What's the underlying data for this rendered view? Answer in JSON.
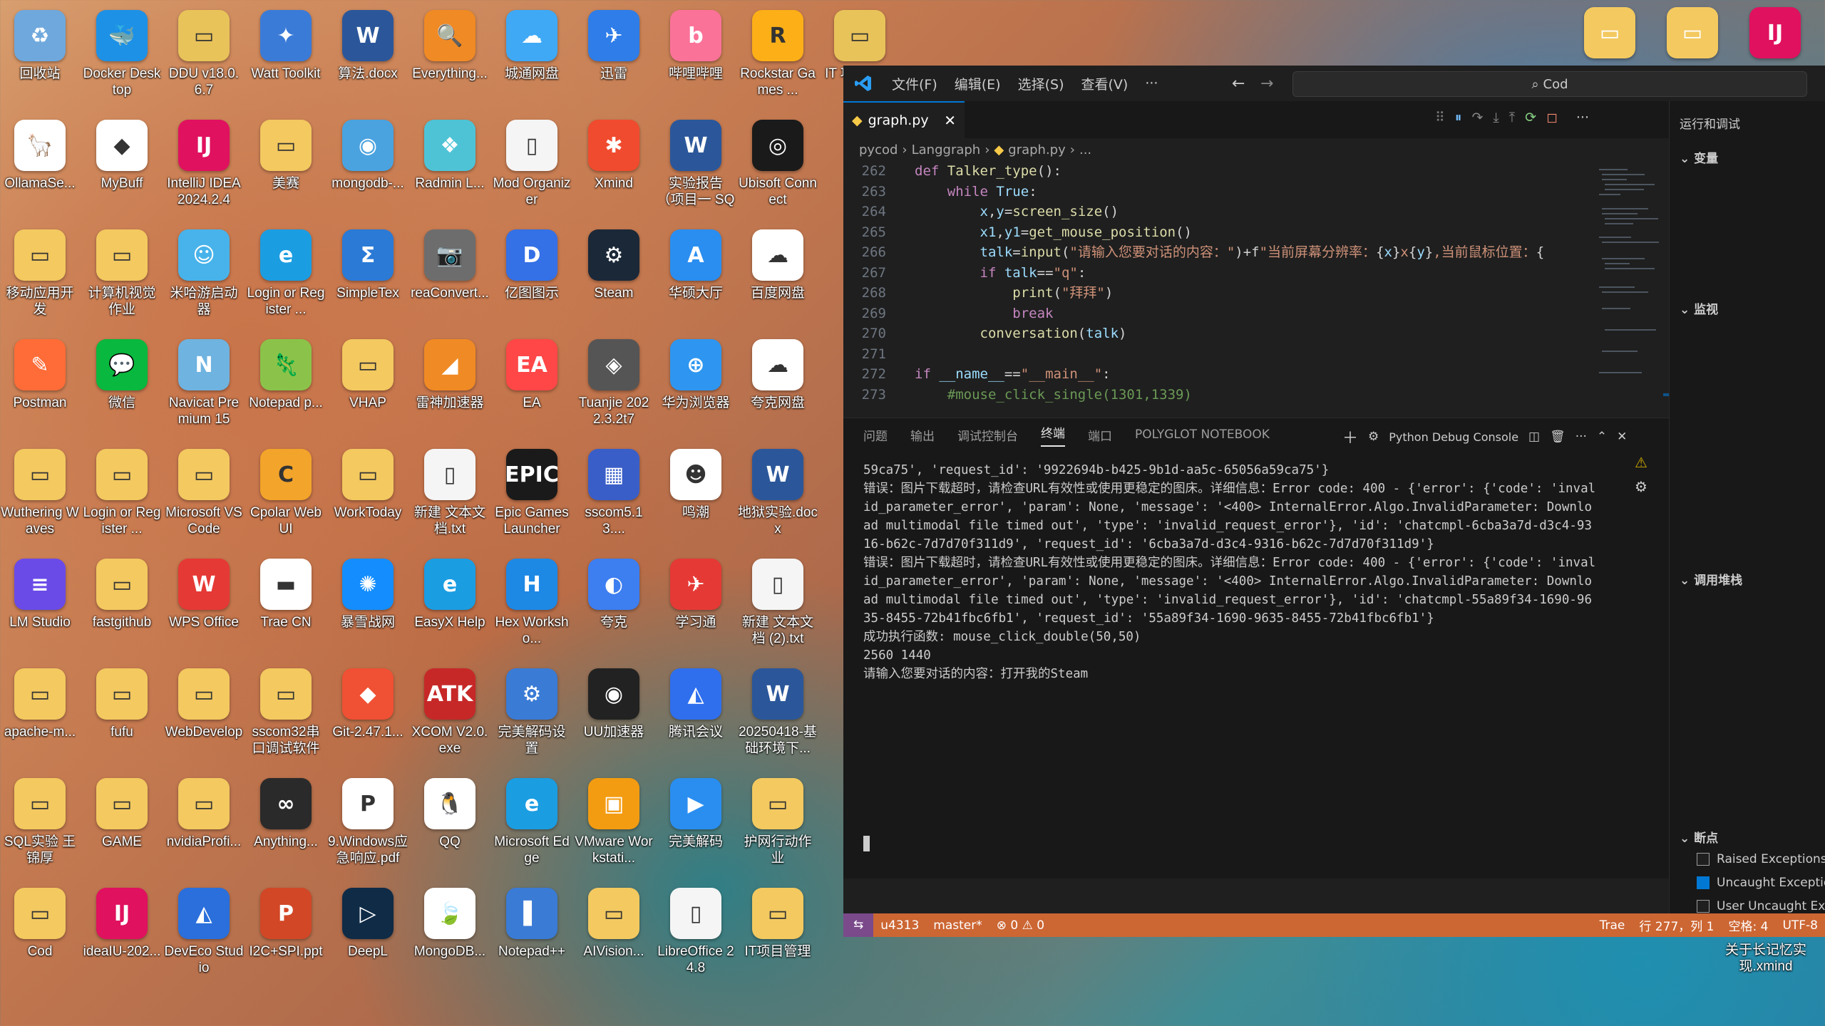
{
  "desktop_icons": [
    {
      "label": "回收站",
      "col": 0,
      "row": 0,
      "color": "#6fa8dc",
      "glyph": "♻"
    },
    {
      "label": "Docker Desktop",
      "col": 1,
      "row": 0,
      "color": "#1d91e6",
      "glyph": "🐳"
    },
    {
      "label": "DDU v18.0.6.7",
      "col": 2,
      "row": 0,
      "color": "#e8c35a",
      "glyph": "▭"
    },
    {
      "label": "Watt Toolkit",
      "col": 3,
      "row": 0,
      "color": "#3b7bd8",
      "glyph": "✦"
    },
    {
      "label": "算法.docx",
      "col": 4,
      "row": 0,
      "color": "#2b579a",
      "glyph": "W"
    },
    {
      "label": "Everything...",
      "col": 5,
      "row": 0,
      "color": "#f08a24",
      "glyph": "🔍"
    },
    {
      "label": "城通网盘",
      "col": 6,
      "row": 0,
      "color": "#3fa9f5",
      "glyph": "☁"
    },
    {
      "label": "迅雷",
      "col": 7,
      "row": 0,
      "color": "#2e7de9",
      "glyph": "✈"
    },
    {
      "label": "哔哩哔哩",
      "col": 8,
      "row": 0,
      "color": "#fb7299",
      "glyph": "b"
    },
    {
      "label": "Rockstar Games ...",
      "col": 9,
      "row": 0,
      "color": "#fcaf17",
      "glyph": "R"
    },
    {
      "label": "IT 项目管理",
      "col": 10,
      "row": 0,
      "color": "#e8c35a",
      "glyph": "▭"
    },
    {
      "label": "OllamaSe...",
      "col": 0,
      "row": 1,
      "color": "#ffffff",
      "glyph": "🦙"
    },
    {
      "label": "MyBuff",
      "col": 1,
      "row": 1,
      "color": "#ffffff",
      "glyph": "◆"
    },
    {
      "label": "IntelliJ IDEA 2024.2.4",
      "col": 2,
      "row": 1,
      "color": "#e0115f",
      "glyph": "IJ"
    },
    {
      "label": "美赛",
      "col": 3,
      "row": 1,
      "color": "#f3c960",
      "glyph": "▭"
    },
    {
      "label": "mongodb-...",
      "col": 4,
      "row": 1,
      "color": "#4aa3df",
      "glyph": "◉"
    },
    {
      "label": "Radmin L...",
      "col": 5,
      "row": 1,
      "color": "#4fc3d6",
      "glyph": "❖"
    },
    {
      "label": "Mod Organizer",
      "col": 6,
      "row": 1,
      "color": "#f5f5f5",
      "glyph": "▯"
    },
    {
      "label": "Xmind",
      "col": 7,
      "row": 1,
      "color": "#f04b2e",
      "glyph": "✱"
    },
    {
      "label": "实验报告（项目一 SQL语...",
      "col": 8,
      "row": 1,
      "color": "#2b579a",
      "glyph": "W"
    },
    {
      "label": "Ubisoft Connect",
      "col": 9,
      "row": 1,
      "color": "#1a1a1a",
      "glyph": "◎"
    },
    {
      "label": "移动应用开发",
      "col": 0,
      "row": 2,
      "color": "#f3c960",
      "glyph": "▭"
    },
    {
      "label": "计算机视觉作业",
      "col": 1,
      "row": 2,
      "color": "#f3c960",
      "glyph": "▭"
    },
    {
      "label": "米哈游启动器",
      "col": 2,
      "row": 2,
      "color": "#48b3ea",
      "glyph": "☺"
    },
    {
      "label": "Login or Register ...",
      "col": 3,
      "row": 2,
      "color": "#1b9de2",
      "glyph": "e"
    },
    {
      "label": "SimpleTex",
      "col": 4,
      "row": 2,
      "color": "#2a7ad6",
      "glyph": "Σ"
    },
    {
      "label": "reaConvert...",
      "col": 5,
      "row": 2,
      "color": "#6d6d6d",
      "glyph": "📷"
    },
    {
      "label": "亿图图示",
      "col": 6,
      "row": 2,
      "color": "#3470e6",
      "glyph": "D"
    },
    {
      "label": "Steam",
      "col": 7,
      "row": 2,
      "color": "#1b2838",
      "glyph": "⚙"
    },
    {
      "label": "华硕大厅",
      "col": 8,
      "row": 2,
      "color": "#2a8ef0",
      "glyph": "A"
    },
    {
      "label": "百度网盘",
      "col": 9,
      "row": 2,
      "color": "#ffffff",
      "glyph": "☁"
    },
    {
      "label": "Postman",
      "col": 0,
      "row": 3,
      "color": "#ff6c37",
      "glyph": "✎"
    },
    {
      "label": "微信",
      "col": 1,
      "row": 3,
      "color": "#09b83e",
      "glyph": "💬"
    },
    {
      "label": "Navicat Premium 15",
      "col": 2,
      "row": 3,
      "color": "#6fb3e0",
      "glyph": "N"
    },
    {
      "label": "Notepad p...",
      "col": 3,
      "row": 3,
      "color": "#8bc34a",
      "glyph": "🦎"
    },
    {
      "label": "VHAP",
      "col": 4,
      "row": 3,
      "color": "#f3c960",
      "glyph": "▭"
    },
    {
      "label": "雷神加速器",
      "col": 5,
      "row": 3,
      "color": "#f08a24",
      "glyph": "◢"
    },
    {
      "label": "EA",
      "col": 6,
      "row": 3,
      "color": "#ff4747",
      "glyph": "EA"
    },
    {
      "label": "Tuanjie 2022.3.2t7",
      "col": 7,
      "row": 3,
      "color": "#555555",
      "glyph": "◈"
    },
    {
      "label": "华为浏览器",
      "col": 8,
      "row": 3,
      "color": "#2e96f0",
      "glyph": "⊕"
    },
    {
      "label": "夸克网盘",
      "col": 9,
      "row": 3,
      "color": "#ffffff",
      "glyph": "☁"
    },
    {
      "label": "Wuthering Waves",
      "col": 0,
      "row": 4,
      "color": "#f3c960",
      "glyph": "▭"
    },
    {
      "label": "Login or Register ...",
      "col": 1,
      "row": 4,
      "color": "#f3c960",
      "glyph": "▭"
    },
    {
      "label": "Microsoft VS Code",
      "col": 2,
      "row": 4,
      "color": "#f3c960",
      "glyph": "▭"
    },
    {
      "label": "Cpolar Web UI",
      "col": 3,
      "row": 4,
      "color": "#f3a42a",
      "glyph": "C"
    },
    {
      "label": "WorkToday",
      "col": 4,
      "row": 4,
      "color": "#f3c960",
      "glyph": "▭"
    },
    {
      "label": "新建 文本文档.txt",
      "col": 5,
      "row": 4,
      "color": "#f5f5f5",
      "glyph": "▯"
    },
    {
      "label": "Epic Games Launcher",
      "col": 6,
      "row": 4,
      "color": "#1a1a1a",
      "glyph": "EPIC"
    },
    {
      "label": "sscom5.13....",
      "col": 7,
      "row": 4,
      "color": "#3a5ec8",
      "glyph": "▦"
    },
    {
      "label": "鸣潮",
      "col": 8,
      "row": 4,
      "color": "#ffffff",
      "glyph": "☻"
    },
    {
      "label": "地狱实验.docx",
      "col": 9,
      "row": 4,
      "color": "#2b579a",
      "glyph": "W"
    },
    {
      "label": "LM Studio",
      "col": 0,
      "row": 5,
      "color": "#6a4be8",
      "glyph": "≡"
    },
    {
      "label": "fastgithub",
      "col": 1,
      "row": 5,
      "color": "#f3c960",
      "glyph": "▭"
    },
    {
      "label": "WPS Office",
      "col": 2,
      "row": 5,
      "color": "#e53935",
      "glyph": "W"
    },
    {
      "label": "Trae CN",
      "col": 3,
      "row": 5,
      "color": "#ffffff",
      "glyph": "▬"
    },
    {
      "label": "暴雪战网",
      "col": 4,
      "row": 5,
      "color": "#148eff",
      "glyph": "✺"
    },
    {
      "label": "EasyX Help",
      "col": 5,
      "row": 5,
      "color": "#1b9de2",
      "glyph": "e"
    },
    {
      "label": "Hex Worksho...",
      "col": 6,
      "row": 5,
      "color": "#1e88e5",
      "glyph": "H"
    },
    {
      "label": "夸克",
      "col": 7,
      "row": 5,
      "color": "#3d7ef0",
      "glyph": "◐"
    },
    {
      "label": "学习通",
      "col": 8,
      "row": 5,
      "color": "#e53935",
      "glyph": "✈"
    },
    {
      "label": "新建 文本文档 (2).txt",
      "col": 9,
      "row": 5,
      "color": "#f5f5f5",
      "glyph": "▯"
    },
    {
      "label": "apache-m...",
      "col": 0,
      "row": 6,
      "color": "#f3c960",
      "glyph": "▭"
    },
    {
      "label": "fufu",
      "col": 1,
      "row": 6,
      "color": "#f3c960",
      "glyph": "▭"
    },
    {
      "label": "WebDevelop",
      "col": 2,
      "row": 6,
      "color": "#f3c960",
      "glyph": "▭"
    },
    {
      "label": "sscom32串口调试软件",
      "col": 3,
      "row": 6,
      "color": "#f3c960",
      "glyph": "▭"
    },
    {
      "label": "Git-2.47.1...",
      "col": 4,
      "row": 6,
      "color": "#f05033",
      "glyph": "◆"
    },
    {
      "label": "XCOM V2.0.exe",
      "col": 5,
      "row": 6,
      "color": "#c62828",
      "glyph": "ATK"
    },
    {
      "label": "完美解码设置",
      "col": 6,
      "row": 6,
      "color": "#3a7bd5",
      "glyph": "⚙"
    },
    {
      "label": "UU加速器",
      "col": 7,
      "row": 6,
      "color": "#222222",
      "glyph": "◉"
    },
    {
      "label": "腾讯会议",
      "col": 8,
      "row": 6,
      "color": "#2f6fed",
      "glyph": "◭"
    },
    {
      "label": "20250418-基础环境下...",
      "col": 9,
      "row": 6,
      "color": "#2b579a",
      "glyph": "W"
    },
    {
      "label": "SQL实验 王锦厚",
      "col": 0,
      "row": 7,
      "color": "#f3c960",
      "glyph": "▭"
    },
    {
      "label": "GAME",
      "col": 1,
      "row": 7,
      "color": "#f3c960",
      "glyph": "▭"
    },
    {
      "label": "nvidiaProfi...",
      "col": 2,
      "row": 7,
      "color": "#f3c960",
      "glyph": "▭"
    },
    {
      "label": "Anything...",
      "col": 3,
      "row": 7,
      "color": "#2a2a2a",
      "glyph": "∞"
    },
    {
      "label": "9.Windows应急响应.pdf",
      "col": 4,
      "row": 7,
      "color": "#ffffff",
      "glyph": "P"
    },
    {
      "label": "QQ",
      "col": 5,
      "row": 7,
      "color": "#ffffff",
      "glyph": "🐧"
    },
    {
      "label": "Microsoft Edge",
      "col": 6,
      "row": 7,
      "color": "#1b9de2",
      "glyph": "e"
    },
    {
      "label": "VMware Workstati...",
      "col": 7,
      "row": 7,
      "color": "#f39c12",
      "glyph": "▣"
    },
    {
      "label": "完美解码",
      "col": 8,
      "row": 7,
      "color": "#2a8ef0",
      "glyph": "▶"
    },
    {
      "label": "护网行动作业",
      "col": 9,
      "row": 7,
      "color": "#f3c960",
      "glyph": "▭"
    },
    {
      "label": "Cod",
      "col": 0,
      "row": 8,
      "color": "#f3c960",
      "glyph": "▭"
    },
    {
      "label": "ideaIU-202...",
      "col": 1,
      "row": 8,
      "color": "#e0115f",
      "glyph": "IJ"
    },
    {
      "label": "DevEco Studio",
      "col": 2,
      "row": 8,
      "color": "#2a6fdb",
      "glyph": "◭"
    },
    {
      "label": "I2C+SPI.ppt",
      "col": 3,
      "row": 8,
      "color": "#d24726",
      "glyph": "P"
    },
    {
      "label": "DeepL",
      "col": 4,
      "row": 8,
      "color": "#0f2b46",
      "glyph": "▷"
    },
    {
      "label": "MongoDB...",
      "col": 5,
      "row": 8,
      "color": "#ffffff",
      "glyph": "🍃"
    },
    {
      "label": "Notepad++",
      "col": 6,
      "row": 8,
      "color": "#3a7bd5",
      "glyph": "▌"
    },
    {
      "label": "AIVision...",
      "col": 7,
      "row": 8,
      "color": "#f3c960",
      "glyph": "▭"
    },
    {
      "label": "LibreOffice 24.8",
      "col": 8,
      "row": 8,
      "color": "#f5f5f5",
      "glyph": "▯"
    },
    {
      "label": "IT项目管理",
      "col": 9,
      "row": 8,
      "color": "#f3c960",
      "glyph": "▭"
    }
  ],
  "right_desktop": {
    "xmind_label": "关于长记忆实现.xmind"
  },
  "vscode": {
    "menu": [
      "文件(F)",
      "编辑(E)",
      "选择(S)",
      "查看(V)",
      "···"
    ],
    "search": "Cod",
    "tab": "graph.py",
    "breadcrumb": [
      "pycod",
      "Langgraph",
      "graph.py",
      "..."
    ],
    "code_lines": [
      {
        "n": "262",
        "html": "<span class='kw'>def</span> <span class='fn'>Talker_type</span>():"
      },
      {
        "n": "263",
        "html": "    <span class='kw'>while</span> <span class='vr'>True</span>:"
      },
      {
        "n": "264",
        "html": "        <span class='vr'>x</span>,<span class='vr'>y</span>=<span class='fn'>screen_size</span>()"
      },
      {
        "n": "265",
        "html": "        <span class='vr'>x1</span>,<span class='vr'>y1</span>=<span class='fn'>get_mouse_position</span>()"
      },
      {
        "n": "266",
        "html": "        <span class='vr'>talk</span>=<span class='fn'>input</span>(<span class='str'>\"请输入您要对话的内容：\"</span>)+f<span class='str'>\"当前屏幕分辨率：</span>{<span class='vr'>x</span>}<span class='str'>x</span>{<span class='vr'>y</span>}<span class='str'>,当前鼠标位置：</span>{"
      },
      {
        "n": "267",
        "html": "        <span class='kw'>if</span> <span class='vr'>talk</span>==<span class='str'>\"q\"</span>:"
      },
      {
        "n": "268",
        "html": "            <span class='fn'>print</span>(<span class='str'>\"拜拜\"</span>)"
      },
      {
        "n": "269",
        "html": "            <span class='kw'>break</span>"
      },
      {
        "n": "270",
        "html": "        <span class='fn'>conversation</span>(<span class='vr'>talk</span>)"
      },
      {
        "n": "271",
        "html": ""
      },
      {
        "n": "272",
        "html": "<span class='kw'>if</span> <span class='vr'>__name__</span>==<span class='str'>\"__main__\"</span>:"
      },
      {
        "n": "273",
        "html": "    <span class='cm'>#mouse_click_single(1301,1339)</span>"
      }
    ],
    "panel_tabs": [
      "问题",
      "输出",
      "调试控制台",
      "终端",
      "端口",
      "POLYGLOT NOTEBOOK"
    ],
    "panel_active": "终端",
    "console_label": "Python Debug Console",
    "terminal": "59ca75', 'request_id': '9922694b-b425-9b1d-aa5c-65056a59ca75'}\n错误：图片下载超时，请检查URL有效性或使用更稳定的图床。详细信息：Error code: 400 - {'error': {'code': 'invalid_parameter_error', 'param': None, 'message': '<400> InternalError.Algo.InvalidParameter: Download multimodal file timed out', 'type': 'invalid_request_error'}, 'id': 'chatcmpl-6cba3a7d-d3c4-9316-b62c-7d7d70f311d9', 'request_id': '6cba3a7d-d3c4-9316-b62c-7d7d70f311d9'}\n错误：图片下载超时，请检查URL有效性或使用更稳定的图床。详细信息：Error code: 400 - {'error': {'code': 'invalid_parameter_error', 'param': None, 'message': '<400> InternalError.Algo.InvalidParameter: Download multimodal file timed out', 'type': 'invalid_request_error'}, 'id': 'chatcmpl-55a89f34-1690-9635-8455-72b41fbc6fb1', 'request_id': '55a89f34-1690-9635-8455-72b41fbc6fb1'}\n成功执行函数: mouse_click_double(50,50)\n2560 1440\n请输入您要对话的内容：打开我的Steam",
    "sidebar": {
      "run_title": "运行和调试",
      "variables": "变量",
      "watch": "监视",
      "callstack": "调用堆栈",
      "breakpoints": "断点",
      "bp_items": [
        {
          "label": "Raised Exceptions",
          "checked": false
        },
        {
          "label": "Uncaught Exceptions",
          "checked": true
        },
        {
          "label": "User Uncaught Exceptions",
          "checked": false
        }
      ]
    },
    "status": {
      "remote": "⇆",
      "user": "u4313",
      "branch": "master*",
      "problems": "⊗ 0 ⚠ 0",
      "trae": "Trae",
      "position": "行 277，列 1",
      "spaces": "空格: 4",
      "encoding": "UTF-8"
    }
  }
}
